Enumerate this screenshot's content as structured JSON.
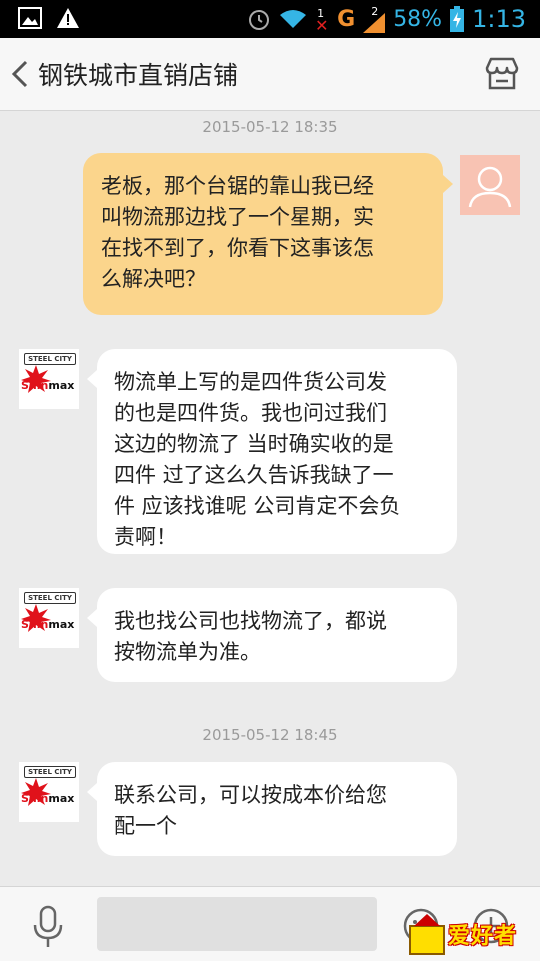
{
  "status_bar": {
    "battery": "58%",
    "time": "1:13",
    "network": "G",
    "sim1": "1",
    "sim2": "2",
    "icons": [
      "image-icon",
      "warning-icon",
      "alarm-icon",
      "wifi-icon",
      "signal-icon",
      "battery-icon"
    ]
  },
  "header": {
    "title": "钢铁城市直销店铺",
    "back_icon": "chevron-left-icon",
    "store_icon": "store-icon"
  },
  "messages": [
    {
      "type": "timestamp",
      "text": "2015-05-12 18:35"
    },
    {
      "type": "outgoing",
      "lines": [
        "老板，那个台锯的靠山我已经",
        "叫物流那边找了一个星期，实",
        "在找不到了，你看下这事该怎",
        "么解决吧？"
      ]
    },
    {
      "type": "incoming",
      "lines": [
        "物流单上写的是四件货公司发",
        "的也是四件货。我也问过我们",
        "这边的物流了 当时确实收的是",
        "四件 过了这么久告诉我缺了一",
        "件 应该找谁呢 公司肯定不会负",
        "责啊！"
      ]
    },
    {
      "type": "incoming",
      "lines": [
        "我也找公司也找物流了，都说",
        "按物流单为准。"
      ]
    },
    {
      "type": "timestamp",
      "text": "2015-05-12 18:45"
    },
    {
      "type": "incoming",
      "lines": [
        "联系公司，可以按成本价给您",
        "配一个"
      ]
    }
  ],
  "shop_logo": {
    "top": "STEEL CITY",
    "brand_red": "Shin",
    "brand_black": "max"
  },
  "input_bar": {
    "placeholder": "",
    "mic_icon": "mic-icon",
    "emoji_icon": "emoji-icon",
    "plus_icon": "plus-icon"
  },
  "watermark": {
    "text": "爱好者"
  },
  "colors": {
    "outgoing_bubble": "#fbd58c",
    "incoming_bubble": "#ffffff",
    "background": "#ebebeb",
    "accent_status": "#35b5e5"
  }
}
